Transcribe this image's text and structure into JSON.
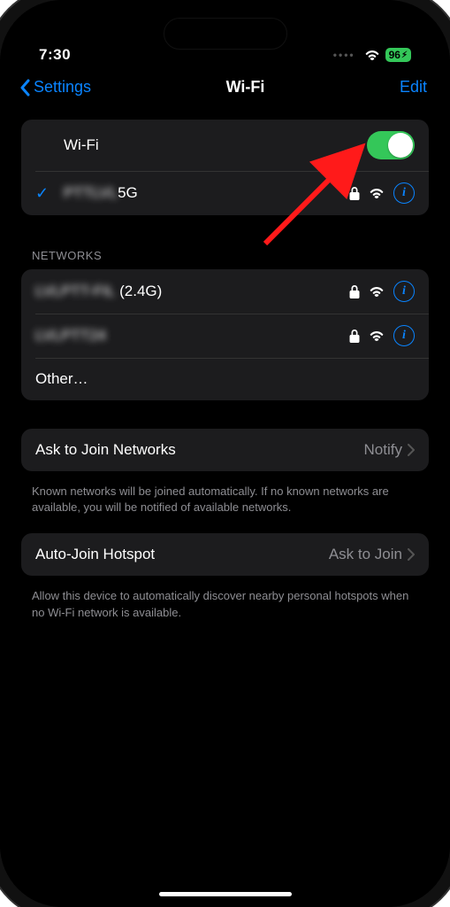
{
  "status_bar": {
    "time": "7:30",
    "battery": "96"
  },
  "nav": {
    "back_label": "Settings",
    "title": "Wi-Fi",
    "edit": "Edit"
  },
  "wifi_toggle": {
    "label": "Wi-Fi",
    "on": true
  },
  "connected_network": {
    "name_blurred": "PTTLVL",
    "name_suffix": "5G"
  },
  "networks_header": "Networks",
  "networks": [
    {
      "name_blurred": "LVLPTT-FIL",
      "suffix": " (2.4G)",
      "secure": true
    },
    {
      "name_blurred": "LVLPTT24",
      "suffix": "",
      "secure": true
    }
  ],
  "other_label": "Other…",
  "ask_to_join": {
    "label": "Ask to Join Networks",
    "value": "Notify",
    "footer": "Known networks will be joined automatically. If no known networks are available, you will be notified of available networks."
  },
  "auto_join": {
    "label": "Auto-Join Hotspot",
    "value": "Ask to Join",
    "footer": "Allow this device to automatically discover nearby personal hotspots when no Wi-Fi network is available."
  }
}
